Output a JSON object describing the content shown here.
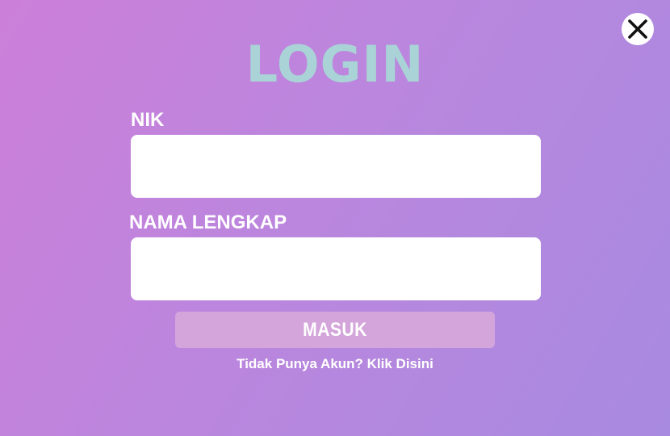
{
  "close": {
    "icon": "close-icon"
  },
  "title": "LOGIN",
  "fields": {
    "nik": {
      "label": "NIK",
      "value": "",
      "placeholder": ""
    },
    "nama_lengkap": {
      "label": "NAMA LENGKAP",
      "value": "",
      "placeholder": ""
    }
  },
  "submit_label": "MASUK",
  "register_link": "Tidak Punya Akun? Klik Disini",
  "colors": {
    "background_start": "#cc7fd9",
    "background_end": "#a88ae0",
    "title": "#a9d3d6",
    "button": "#d4a5db",
    "text": "#ffffff"
  }
}
